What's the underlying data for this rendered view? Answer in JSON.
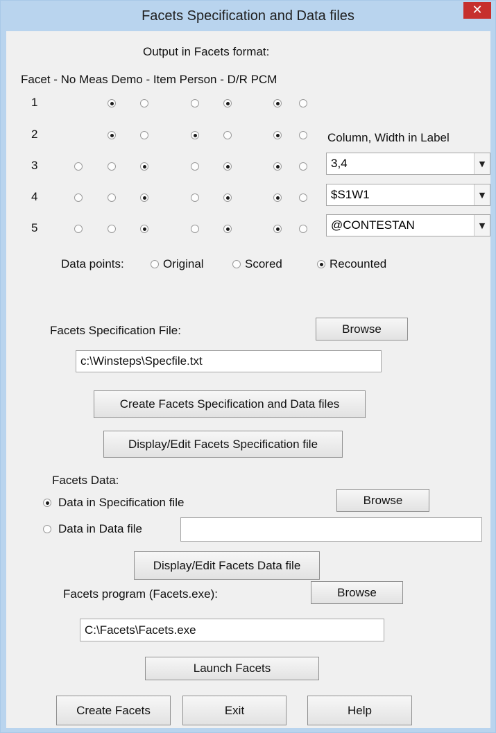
{
  "window": {
    "title": "Facets Specification and Data files",
    "close_glyph": "✕"
  },
  "output": {
    "heading": "Output in Facets format:",
    "columns_header": "Facet - No Meas Demo - Item Person - D/R PCM",
    "rows": [
      {
        "label": "1",
        "no": null,
        "meas": true,
        "demo": false,
        "item": false,
        "person": true,
        "dr": true,
        "pcm": false
      },
      {
        "label": "2",
        "no": null,
        "meas": true,
        "demo": false,
        "item": true,
        "person": false,
        "dr": true,
        "pcm": false
      },
      {
        "label": "3",
        "no": false,
        "meas": false,
        "demo": true,
        "item": false,
        "person": true,
        "dr": true,
        "pcm": false
      },
      {
        "label": "4",
        "no": false,
        "meas": false,
        "demo": true,
        "item": false,
        "person": true,
        "dr": true,
        "pcm": false
      },
      {
        "label": "5",
        "no": false,
        "meas": false,
        "demo": true,
        "item": false,
        "person": true,
        "dr": true,
        "pcm": false
      }
    ],
    "column_width_label": "Column, Width in Label",
    "combos": [
      "3,4",
      "$S1W1",
      "@CONTESTAN"
    ]
  },
  "data_points": {
    "label": "Data points:",
    "options": [
      {
        "label": "Original",
        "selected": false
      },
      {
        "label": "Scored",
        "selected": false
      },
      {
        "label": "Recounted",
        "selected": true
      }
    ]
  },
  "spec_file": {
    "label": "Facets Specification File:",
    "browse_label": "Browse",
    "path": "c:\\Winsteps\\Specfile.txt"
  },
  "create_button": "Create Facets Specification and Data files",
  "display_spec_button": "Display/Edit Facets Specification file",
  "facets_data": {
    "label": "Facets Data:",
    "option_in_spec": "Data in Specification file",
    "option_in_spec_selected": true,
    "option_in_file": "Data in Data file",
    "option_in_file_selected": false,
    "browse_label": "Browse",
    "data_file_path": "",
    "display_data_button": "Display/Edit Facets Data file"
  },
  "program": {
    "label": "Facets program (Facets.exe):",
    "browse_label": "Browse",
    "path": "C:\\Facets\\Facets.exe"
  },
  "launch_button": "Launch Facets",
  "footer": {
    "create": "Create Facets",
    "exit": "Exit",
    "help": "Help"
  }
}
